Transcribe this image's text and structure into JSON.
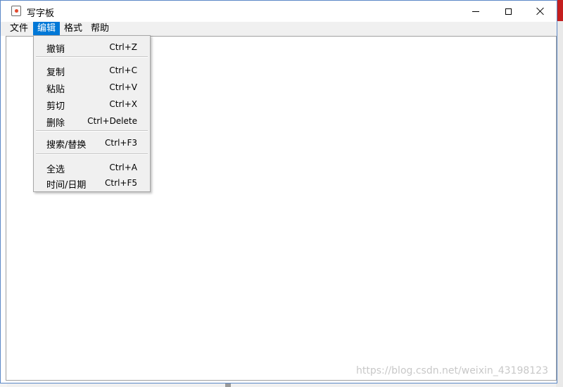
{
  "window": {
    "title": "写字板",
    "icon": "java-cup-icon"
  },
  "menubar": {
    "items": [
      {
        "label": "文件"
      },
      {
        "label": "编辑"
      },
      {
        "label": "格式"
      },
      {
        "label": "帮助"
      }
    ],
    "active_index": 1
  },
  "edit_menu": {
    "groups": [
      [
        {
          "label": "撤销",
          "shortcut": "Ctrl+Z"
        }
      ],
      [
        {
          "label": "复制",
          "shortcut": "Ctrl+C"
        },
        {
          "label": "粘贴",
          "shortcut": "Ctrl+V"
        },
        {
          "label": "剪切",
          "shortcut": "Ctrl+X"
        },
        {
          "label": "删除",
          "shortcut": "Ctrl+Delete"
        }
      ],
      [
        {
          "label": "搜索/替换",
          "shortcut": "Ctrl+F3"
        }
      ],
      [
        {
          "label": "全选",
          "shortcut": "Ctrl+A"
        },
        {
          "label": "时间/日期",
          "shortcut": "Ctrl+F5"
        }
      ]
    ]
  },
  "watermark": "https://blog.csdn.net/weixin_43198123",
  "colors": {
    "accent": "#0078d7",
    "window_border": "#5b88c7"
  }
}
